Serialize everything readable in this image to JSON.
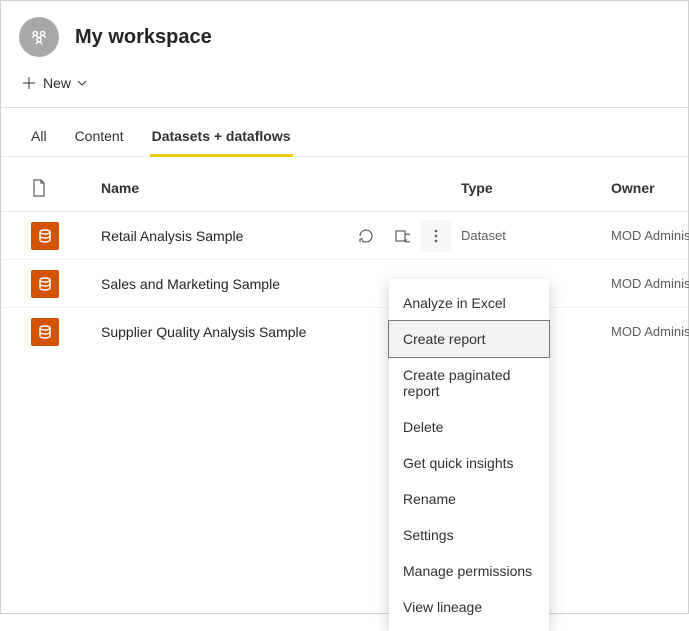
{
  "workspace": {
    "title": "My workspace",
    "new_label": "New"
  },
  "tabs": {
    "all": "All",
    "content": "Content",
    "datasets": "Datasets + dataflows"
  },
  "columns": {
    "name": "Name",
    "type": "Type",
    "owner": "Owner"
  },
  "rows": [
    {
      "name": "Retail Analysis Sample",
      "type": "Dataset",
      "owner": "MOD Administrator"
    },
    {
      "name": "Sales and Marketing Sample",
      "type": "",
      "owner": "MOD Administrator"
    },
    {
      "name": "Supplier Quality Analysis Sample",
      "type": "",
      "owner": "MOD Administrator"
    }
  ],
  "menu": {
    "analyze": "Analyze in Excel",
    "create_report": "Create report",
    "create_paginated": "Create paginated report",
    "delete": "Delete",
    "quick_insights": "Get quick insights",
    "rename": "Rename",
    "settings": "Settings",
    "manage_perms": "Manage permissions",
    "view_lineage": "View lineage"
  }
}
